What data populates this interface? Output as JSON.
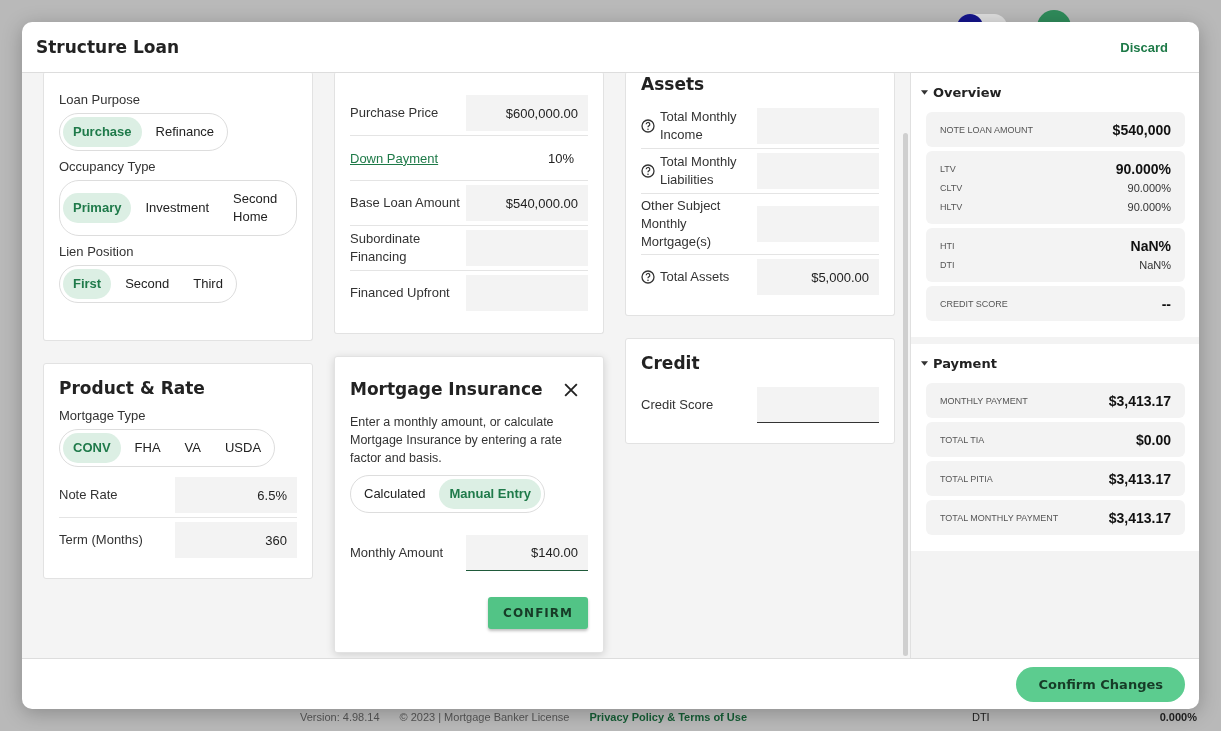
{
  "backdrop": {
    "version": "Version: 4.98.14",
    "copyright": "© 2023 | Mortgage Banker License",
    "policy_link": "Privacy Policy & Terms of Use",
    "summary_label": "DTI",
    "summary_value": "0.000%"
  },
  "window": {
    "title": "Structure Loan",
    "discard": "Discard"
  },
  "loan_card": {
    "groups": [
      {
        "label": "Loan Purpose",
        "options": [
          {
            "label": "Purchase",
            "selected": true
          },
          {
            "label": "Refinance",
            "selected": false
          }
        ]
      },
      {
        "label": "Occupancy Type",
        "options": [
          {
            "label": "Primary",
            "selected": true
          },
          {
            "label": "Investment",
            "selected": false
          },
          {
            "label": "Second Home",
            "selected": false
          }
        ]
      },
      {
        "label": "Lien Position",
        "options": [
          {
            "label": "First",
            "selected": true
          },
          {
            "label": "Second",
            "selected": false
          },
          {
            "label": "Third",
            "selected": false
          }
        ]
      }
    ]
  },
  "product_rate": {
    "title": "Product & Rate",
    "mortgage_type": {
      "label": "Mortgage Type",
      "options": [
        {
          "label": "CONV",
          "selected": true
        },
        {
          "label": "FHA",
          "selected": false
        },
        {
          "label": "VA",
          "selected": false
        },
        {
          "label": "USDA",
          "selected": false
        }
      ]
    },
    "rows": [
      {
        "label": "Note Rate",
        "value": "6.5%"
      },
      {
        "label": "Term (Months)",
        "value": "360"
      }
    ]
  },
  "price_card": {
    "rows": [
      {
        "kind": "field",
        "label": "Purchase Price",
        "value": "$600,000.00"
      },
      {
        "kind": "link",
        "label": "Down Payment",
        "value": "10%"
      },
      {
        "kind": "field",
        "label": "Base Loan Amount",
        "value": "$540,000.00"
      },
      {
        "kind": "field",
        "label": "Subordinate Financing"
      },
      {
        "kind": "field",
        "label": "Financed Upfront"
      }
    ]
  },
  "mortgage_insurance": {
    "title": "Mortgage Insurance",
    "description": "Enter a monthly amount, or calculate Mortgage Insurance by entering a rate factor and basis.",
    "modes": [
      {
        "label": "Calculated",
        "selected": false
      },
      {
        "label": "Manual Entry",
        "selected": true
      }
    ],
    "amount_label": "Monthly Amount",
    "amount_value": "$140.00",
    "confirm": "CONFIRM"
  },
  "assets": {
    "title": "Assets",
    "rows": [
      {
        "label": "Total Monthly Income",
        "help": true
      },
      {
        "label": "Total Monthly Liabilities",
        "help": true
      },
      {
        "label": "Other Subject Monthly Mortgage(s)",
        "help": false
      },
      {
        "label": "Total Assets",
        "help": true,
        "value": "$5,000.00"
      }
    ]
  },
  "credit": {
    "title": "Credit",
    "field_label": "Credit Score"
  },
  "overview": {
    "title": "Overview",
    "expanded": true,
    "cards": [
      {
        "items": [
          {
            "label": "NOTE LOAN AMOUNT",
            "value": "$540,000",
            "kind": "major"
          }
        ]
      },
      {
        "items": [
          {
            "label": "LTV",
            "value": "90.000%",
            "kind": "major"
          },
          {
            "label": "CLTV",
            "value": "90.000%",
            "kind": "minor"
          },
          {
            "label": "HLTV",
            "value": "90.000%",
            "kind": "minor"
          }
        ]
      },
      {
        "items": [
          {
            "label": "HTI",
            "value": "NaN%",
            "kind": "major"
          },
          {
            "label": "DTI",
            "value": "NaN%",
            "kind": "minor"
          }
        ]
      },
      {
        "items": [
          {
            "label": "CREDIT SCORE",
            "value": "--",
            "kind": "major"
          }
        ]
      }
    ]
  },
  "payment": {
    "title": "Payment",
    "expanded": true,
    "cards": [
      {
        "items": [
          {
            "label": "MONTHLY PAYMENT",
            "value": "$3,413.17",
            "kind": "major"
          }
        ]
      },
      {
        "items": [
          {
            "label": "TOTAL TIA",
            "value": "$0.00",
            "kind": "major"
          }
        ]
      },
      {
        "items": [
          {
            "label": "TOTAL PITIA",
            "value": "$3,413.17",
            "kind": "major"
          }
        ]
      },
      {
        "items": [
          {
            "label": "TOTAL MONTHLY PAYMENT",
            "value": "$3,413.17",
            "kind": "major"
          }
        ]
      }
    ]
  },
  "footer": {
    "confirm": "Confirm Changes"
  }
}
